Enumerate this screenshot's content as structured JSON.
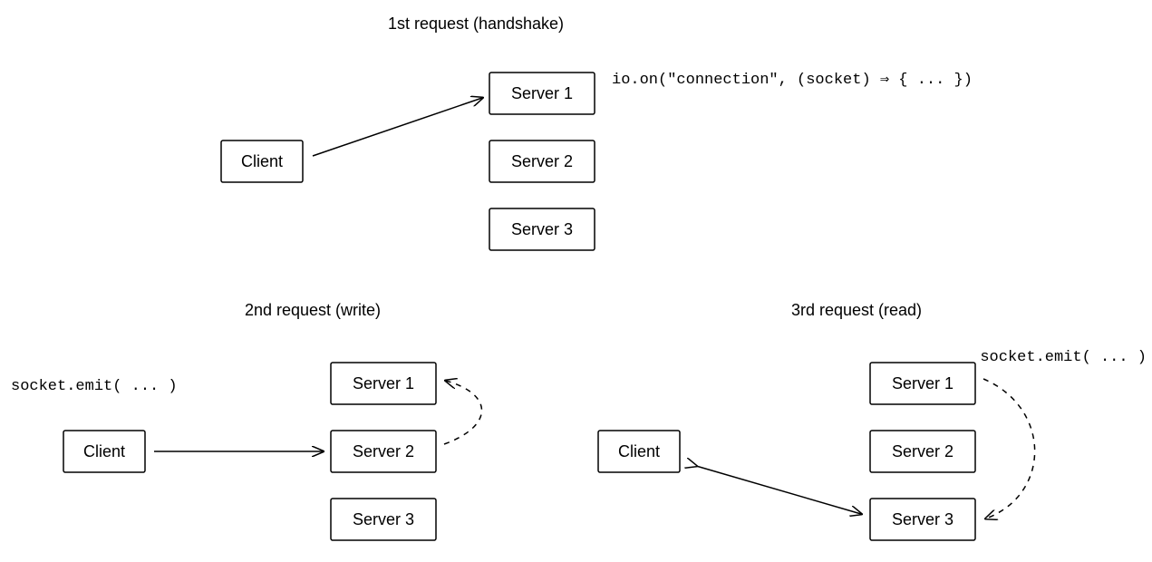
{
  "section1": {
    "title": "1st request (handshake)",
    "client": "Client",
    "servers": [
      "Server 1",
      "Server 2",
      "Server 3"
    ],
    "code": "io.on(\"connection\", (socket) ⇒ { ... })"
  },
  "section2": {
    "title": "2nd request (write)",
    "client": "Client",
    "servers": [
      "Server 1",
      "Server 2",
      "Server 3"
    ],
    "code": "socket.emit( ... )"
  },
  "section3": {
    "title": "3rd request (read)",
    "client": "Client",
    "servers": [
      "Server 1",
      "Server 2",
      "Server 3"
    ],
    "code": "socket.emit( ... )"
  }
}
